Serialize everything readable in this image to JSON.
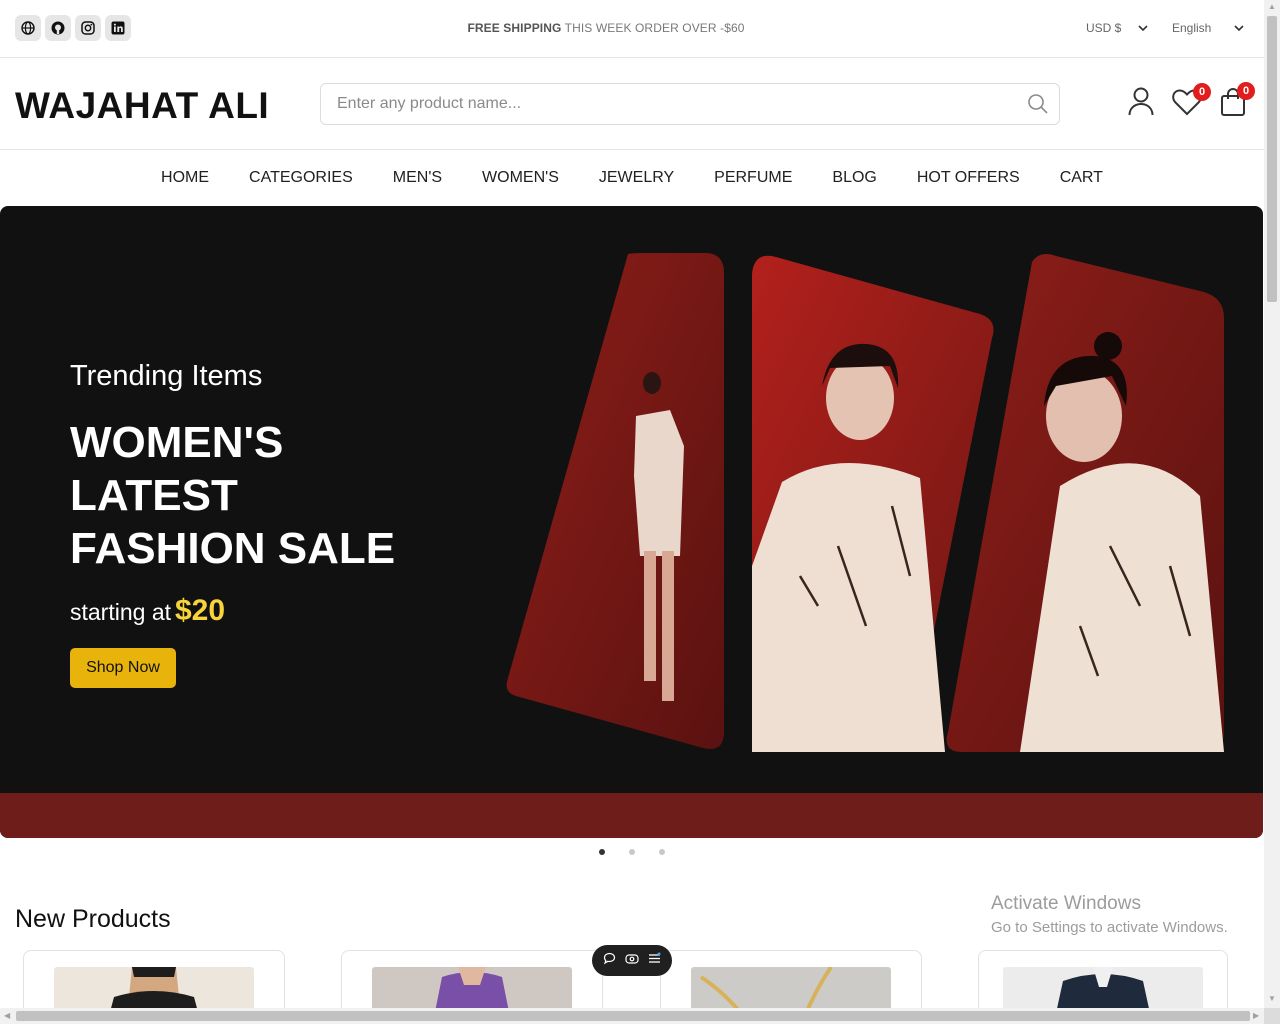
{
  "topbar": {
    "social_icons": [
      "globe-icon",
      "github-icon",
      "instagram-icon",
      "linkedin-icon"
    ],
    "shipping_bold": "FREE SHIPPING",
    "shipping_text": "THIS WEEK ORDER OVER -$60",
    "currency": "USD $",
    "language": "English"
  },
  "header": {
    "logo": "WAJAHAT ALI",
    "search_placeholder": "Enter any product name...",
    "wishlist_count": "0",
    "cart_count": "0"
  },
  "nav": [
    "HOME",
    "CATEGORIES",
    "MEN'S",
    "WOMEN'S",
    "JEWELRY",
    "PERFUME",
    "BLOG",
    "HOT OFFERS",
    "CART"
  ],
  "hero": {
    "subtitle": "Trending Items",
    "title_lines": [
      "WOMEN'S",
      "LATEST",
      "FASHION SALE"
    ],
    "price_prefix": "starting at",
    "price": "$20",
    "button": "Shop Now",
    "slide_count": 3,
    "active_slide": 1
  },
  "new_products": {
    "title": "New Products"
  },
  "overlay": {
    "activate_title": "Activate Windows",
    "activate_sub": "Go to Settings to activate Windows."
  },
  "colors": {
    "accent_yellow": "#e8b40c",
    "price_yellow": "#f8d33c",
    "hero_bg": "#111112",
    "hero_band": "#6e1d1b",
    "badge_red": "#e11d1d"
  }
}
